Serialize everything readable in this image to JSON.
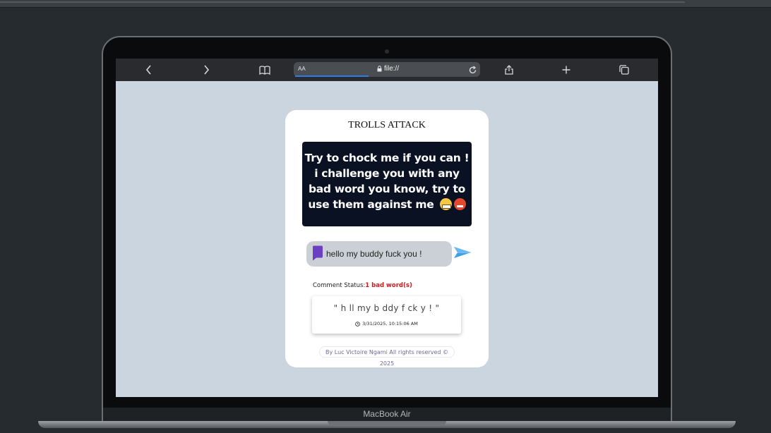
{
  "browser": {
    "reader_label": "AA",
    "url": "file://"
  },
  "page": {
    "title": "TROLLS ATTACK",
    "banner_text": "Try to chock me if you can ! i challenge you with any bad word you know, try to use them against me",
    "input": {
      "value": "hello my buddy fuck you !"
    },
    "status": {
      "label": "Comment Status:",
      "value": "1 bad word(s)"
    },
    "comment": {
      "text": "\" h ll my b ddy f ck y ! \"",
      "timestamp": "3/31/2025, 10:15:06 AM"
    },
    "footer": "By Luc Victoire Ngami All rights reserved © 2025"
  },
  "device": {
    "brand": "MacBook Air"
  },
  "colors": {
    "page_background": "#cbd5e0",
    "banner_background": "#0a1122",
    "bad_word_status": "#d01a1a",
    "send_icon": "#3fa0e8",
    "chat_icon": "#6a3fc1"
  },
  "icons": [
    "back-icon",
    "forward-icon",
    "bookmarks-icon",
    "lock-icon",
    "reload-icon",
    "share-icon",
    "new-tab-icon",
    "tabs-icon",
    "chat-bubble-icon",
    "send-icon",
    "clock-icon",
    "grinning-emoji-icon",
    "angry-emoji-icon"
  ]
}
